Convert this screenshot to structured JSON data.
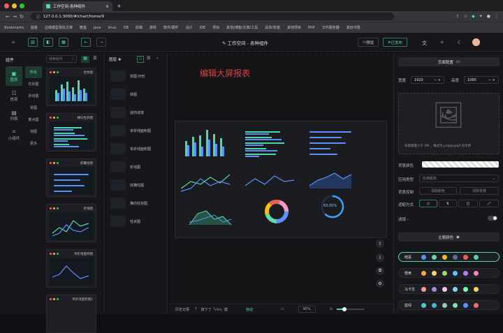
{
  "browser": {
    "tab_title": "工作空间-各种组件",
    "url": "127.0.0.1:3000/#/chart/home/9",
    "bookmarks_label": "Bookmarks",
    "bookmarks": [
      "掘金",
      "边缘模型相关文章",
      "教室",
      "Java",
      "linux",
      "DB",
      "前端",
      "游戏",
      "软件/硬件",
      "设计",
      "IDE",
      "项目",
      "其他/博客/文章/工具",
      "具体/安装",
      "其他项目",
      "PHP",
      "文件服务器",
      "其他书签"
    ]
  },
  "header": {
    "title": "工作空间 - 各种组件",
    "preview_label": "预览",
    "publish_label": "已发布"
  },
  "left": {
    "panel_label": "组件",
    "categories": [
      {
        "icon": "▣",
        "label": "图表"
      },
      {
        "icon": "☷",
        "label": "信息"
      },
      {
        "icon": "▤",
        "label": "列表"
      },
      {
        "icon": "⌗",
        "label": "小组件"
      }
    ],
    "subcategories": [
      "所有",
      "柱状图",
      "折线图",
      "饼图",
      "散点图",
      "地图",
      "更多"
    ],
    "search_placeholder": "搜索组件",
    "thumbs": [
      "柱状图",
      "横向柱状图",
      "胶囊柱图",
      "折线图",
      "单折线面积图",
      "单折线面积图2"
    ]
  },
  "layers": {
    "label": "图层",
    "items": [
      "饼图-环形",
      "饼图",
      "迷你进度",
      "单折线面积图",
      "单折线面积图",
      "折线图",
      "双横柱图",
      "横向柱状图",
      "柱状图"
    ]
  },
  "canvas": {
    "big_title": "编辑大屏报表",
    "donut_label": "63.00%"
  },
  "footer": {
    "history_label": "历史记录",
    "hint": "按下了「ctrl」键",
    "status": "自动",
    "zoom": "95%"
  },
  "right": {
    "page_config_label": "页面配置",
    "width_label": "宽度",
    "width_value": "1920",
    "height_label": "高度",
    "height_value": "1080",
    "upload_hint": "背景图需小于 5M ，格式为 png/jpg/gif 的文件",
    "bg_color_label": "背景颜色",
    "apply_type_label": "应用类型",
    "apply_type_value": "应用颜色",
    "bg_control_label": "背景控制",
    "clear_color_label": "清除颜色",
    "clear_bg_label": "清除背景",
    "fit_label": "适配方式",
    "filter_label": "滤镜",
    "theme_label": "主题颜色",
    "themes": [
      {
        "name": "暗黑",
        "colors": [
          "#5b8ff9",
          "#61d9a9",
          "#f6bd16",
          "#5d7092",
          "#e86452",
          "#51d6a9"
        ]
      },
      {
        "name": "橙黄",
        "colors": [
          "#ffa940",
          "#ffd666",
          "#95de64",
          "#69c0ff",
          "#b37feb",
          "#ff85c0"
        ]
      },
      {
        "name": "马卡龙",
        "colors": [
          "#ff9a9e",
          "#a18cd1",
          "#fbc2eb",
          "#8fd3f4",
          "#84fab0",
          "#f6d365"
        ]
      },
      {
        "name": "蓝绿",
        "colors": [
          "#4ecdc4",
          "#45b7d1",
          "#96ceb4",
          "#88d8b0",
          "#5b8ff9",
          "#ff6b6b"
        ]
      }
    ]
  }
}
